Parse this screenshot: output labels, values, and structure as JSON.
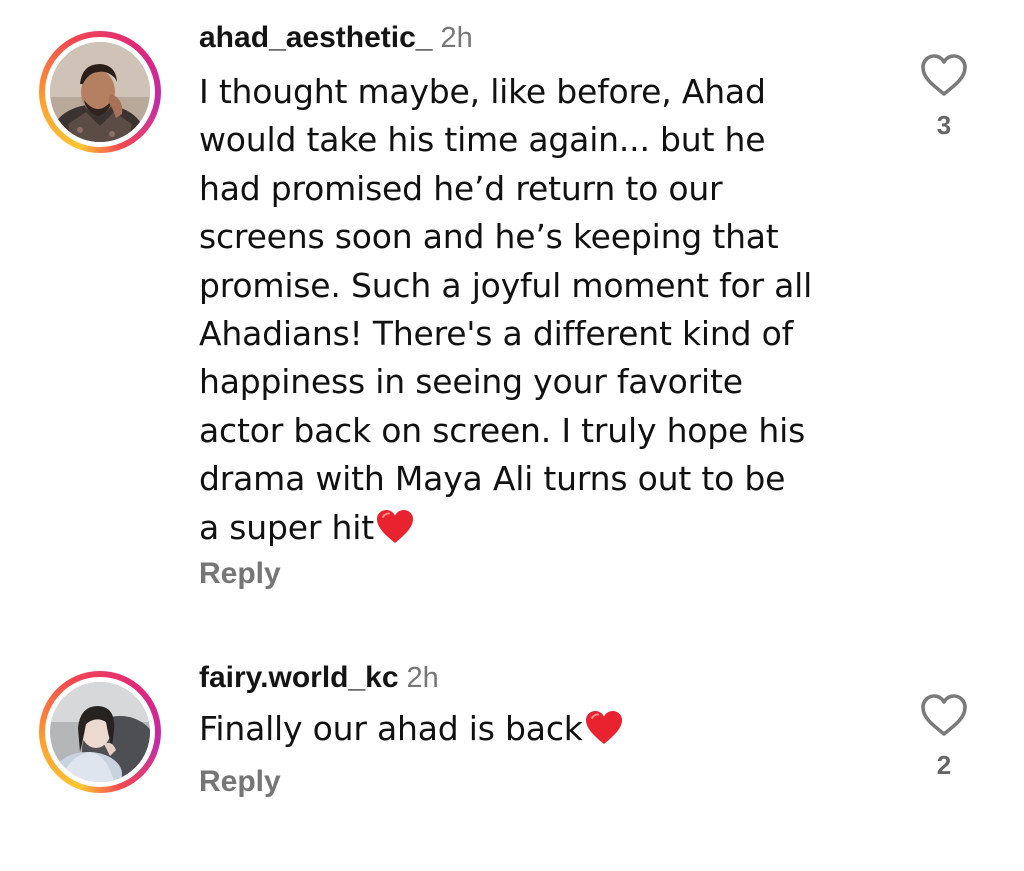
{
  "comments": [
    {
      "username": "ahad_aesthetic_",
      "time": "2h",
      "lines": [
        "I thought maybe, like before, Ahad",
        "would take his time again... but he",
        "had promised he’d return to our",
        "screens soon and he’s keeping that",
        "promise. Such a joyful moment for all",
        "Ahadians! There's a different kind of",
        "happiness in seeing your favorite",
        "actor back on screen. I truly hope his",
        "drama with Maya Ali turns out to be",
        "a super hit"
      ],
      "reply_label": "Reply",
      "like_count": "3",
      "icons": {
        "like": "heart-outline-icon",
        "emoji": "red-heart-emoji"
      }
    },
    {
      "username": "fairy.world_kc",
      "time": "2h",
      "lines": [
        "Finally our ahad is back"
      ],
      "reply_label": "Reply",
      "like_count": "2",
      "icons": {
        "like": "heart-outline-icon",
        "emoji": "red-heart-emoji"
      }
    }
  ],
  "colors": {
    "story_ring": [
      "#fdc631",
      "#f5484f",
      "#c12ba8"
    ],
    "heart_emoji": "#e8232f",
    "secondary_text": "#777777"
  }
}
